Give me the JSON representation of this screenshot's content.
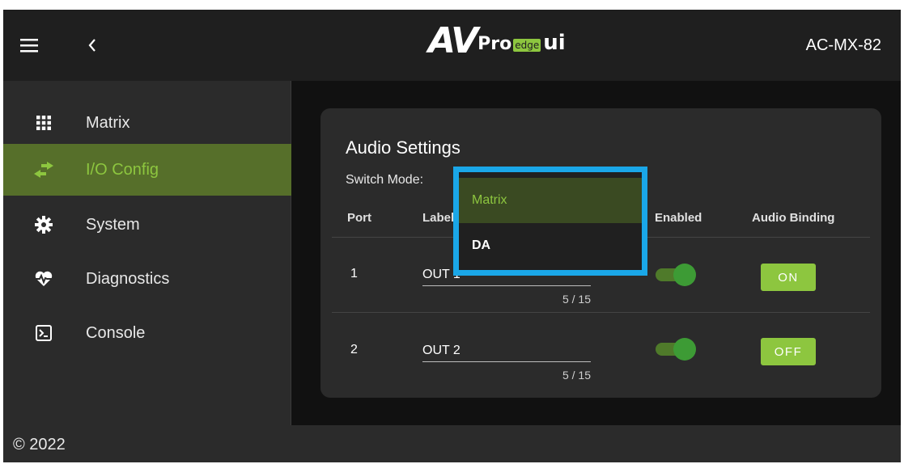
{
  "header": {
    "logo": {
      "av": "AV",
      "pro": "Pro",
      "edge": "edge",
      "ui": "ui"
    },
    "device_name": "AC-MX-82",
    "menu_icon": "hamburger-menu-icon",
    "back_icon": "chevron-left-icon"
  },
  "sidebar": {
    "items": [
      {
        "label": "Matrix",
        "icon": "grid-icon",
        "active": false
      },
      {
        "label": "I/O Config",
        "icon": "swap-arrows-icon",
        "active": true
      },
      {
        "label": "System",
        "icon": "gear-icon",
        "active": false
      },
      {
        "label": "Diagnostics",
        "icon": "heartbeat-icon",
        "active": false
      },
      {
        "label": "Console",
        "icon": "terminal-icon",
        "active": false
      }
    ]
  },
  "audio_settings": {
    "title": "Audio Settings",
    "switch_mode_label": "Switch Mode:",
    "columns": {
      "port": "Port",
      "label": "Label",
      "enabled": "Enabled",
      "audio_binding": "Audio Binding"
    },
    "rows": [
      {
        "port": "1",
        "label": "OUT 1",
        "counter": "5 / 15",
        "enabled": true,
        "audio_binding": "ON"
      },
      {
        "port": "2",
        "label": "OUT 2",
        "counter": "5 / 15",
        "enabled": true,
        "audio_binding": "OFF"
      }
    ]
  },
  "switch_mode_dropdown": {
    "options": [
      "Matrix",
      "DA"
    ],
    "highlighted": "Matrix"
  },
  "footer": {
    "copyright": "© 2022"
  },
  "colors": {
    "accent_green": "#8dc63f",
    "active_nav_bg": "#566f2a",
    "highlight_border": "#1aa7e8",
    "toggle_on": "#3d9b35"
  }
}
